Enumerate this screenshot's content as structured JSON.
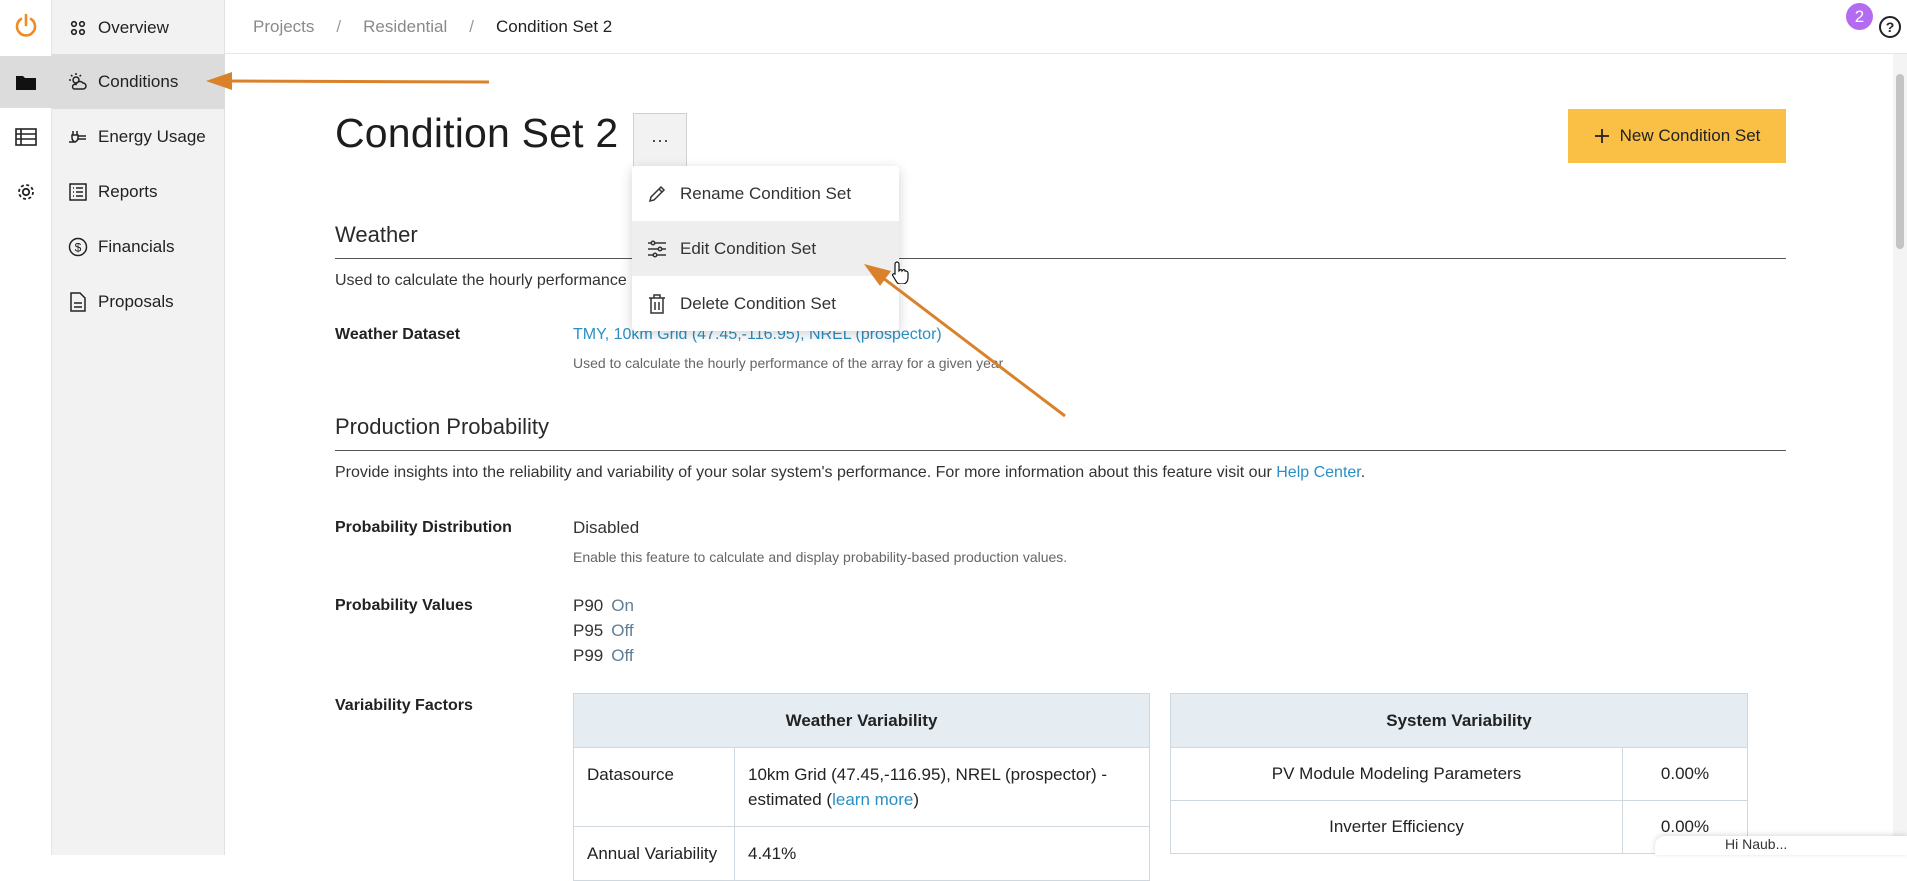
{
  "breadcrumbs": [
    "Projects",
    "Residential",
    "Condition Set 2"
  ],
  "notifications_count": "2",
  "help_label": "?",
  "sidebar": {
    "items": [
      {
        "label": "Overview",
        "icon": "overview-icon"
      },
      {
        "label": "Conditions",
        "icon": "conditions-icon",
        "active": true
      },
      {
        "label": "Energy Usage",
        "icon": "plug-icon"
      },
      {
        "label": "Reports",
        "icon": "reports-icon"
      },
      {
        "label": "Financials",
        "icon": "dollar-icon"
      },
      {
        "label": "Proposals",
        "icon": "document-icon"
      }
    ]
  },
  "page": {
    "title": "Condition Set 2",
    "more_label": "···",
    "new_button": "New Condition Set"
  },
  "menu": {
    "items": [
      {
        "label": "Rename Condition Set",
        "icon": "pencil-icon"
      },
      {
        "label": "Edit Condition Set",
        "icon": "sliders-icon"
      },
      {
        "label": "Delete Condition Set",
        "icon": "trash-icon"
      }
    ]
  },
  "weather": {
    "heading": "Weather",
    "description": "Used to calculate the hourly performance",
    "dataset_label": "Weather Dataset",
    "dataset_value": "TMY, 10km Grid (47.45,-116.95), NREL (prospector)",
    "dataset_help": "Used to calculate the hourly performance of the array for a given year"
  },
  "production": {
    "heading": "Production Probability",
    "description": "Provide insights into the reliability and variability of your solar system's performance. For more information about this feature visit our",
    "help_link": "Help Center",
    "period": ".",
    "distribution_label": "Probability Distribution",
    "distribution_value": "Disabled",
    "distribution_help": "Enable this feature to calculate and display probability-based production values.",
    "values_label": "Probability Values",
    "values": [
      {
        "name": "P90",
        "state": "On"
      },
      {
        "name": "P95",
        "state": "Off"
      },
      {
        "name": "P99",
        "state": "Off"
      }
    ],
    "variability_label": "Variability Factors",
    "weather_table": {
      "header": "Weather Variability",
      "rows": [
        {
          "key": "Datasource",
          "value": "10km Grid (47.45,-116.95), NREL (prospector) - estimated (",
          "link": "learn more",
          "tail": ")"
        },
        {
          "key": "Annual Variability",
          "value": "4.41%"
        }
      ]
    },
    "system_table": {
      "header": "System Variability",
      "rows": [
        {
          "key": "PV Module Modeling Parameters",
          "value": "0.00%"
        },
        {
          "key": "Inverter Efficiency",
          "value": "0.00%"
        }
      ]
    }
  },
  "chat_peek": "Hi Naub..."
}
